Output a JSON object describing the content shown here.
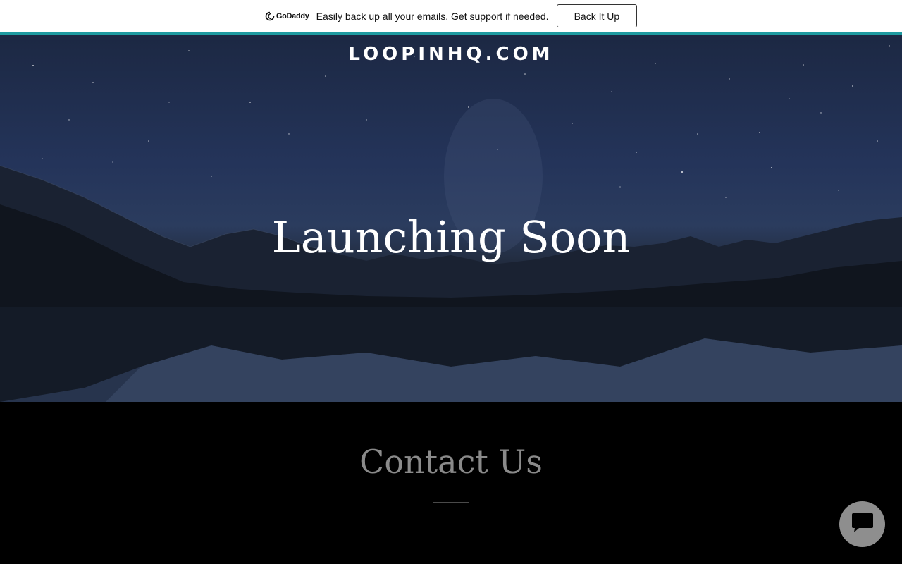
{
  "banner": {
    "logo_word": "GoDaddy",
    "logo_icon": "godaddy-logo-icon",
    "message": "Easily back up all your emails. Get support if needed.",
    "button_label": "Back It Up",
    "accent_color": "#1e9aa0"
  },
  "hero": {
    "site_title": "LOOPINHQ.COM",
    "heading": "Launching Soon"
  },
  "contact": {
    "heading": "Contact Us"
  },
  "chat": {
    "icon": "chat-bubble-icon"
  }
}
